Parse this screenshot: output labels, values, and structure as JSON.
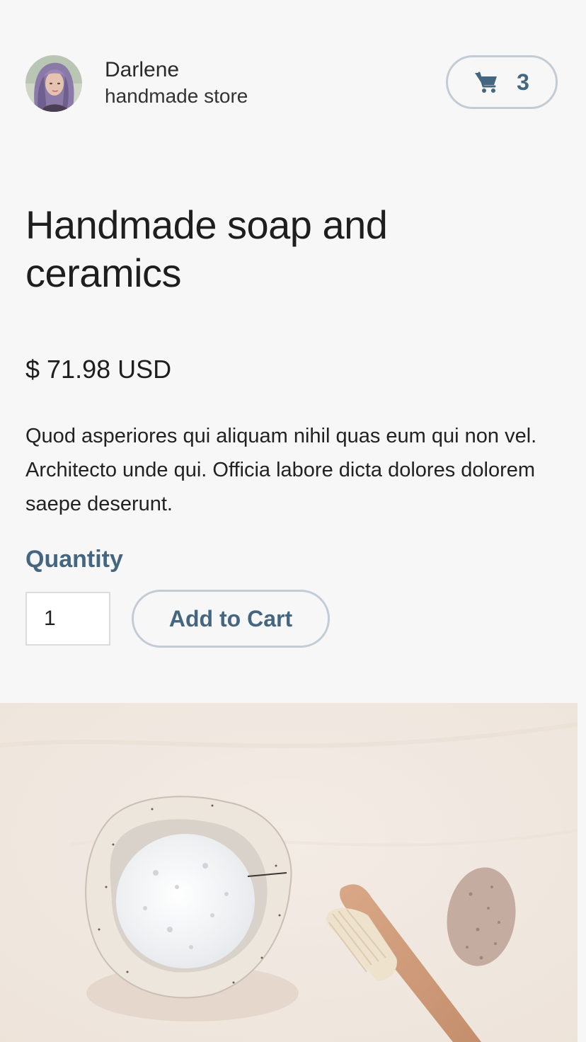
{
  "store": {
    "name": "Darlene",
    "tagline": "handmade store"
  },
  "cart": {
    "count": "3",
    "icon": "cart-icon"
  },
  "product": {
    "title": "Handmade soap and ceramics",
    "price": "$ 71.98 USD",
    "description": "Quod asperiores qui aliquam nihil quas eum qui non vel. Architecto unde qui. Officia labore dicta dolores dolorem saepe deserunt.",
    "quantity_label": "Quantity",
    "quantity_value": "1",
    "add_to_cart_label": "Add to Cart"
  },
  "colors": {
    "accent": "#456680",
    "border": "#c3ccd5",
    "background": "#f7f7f7"
  }
}
